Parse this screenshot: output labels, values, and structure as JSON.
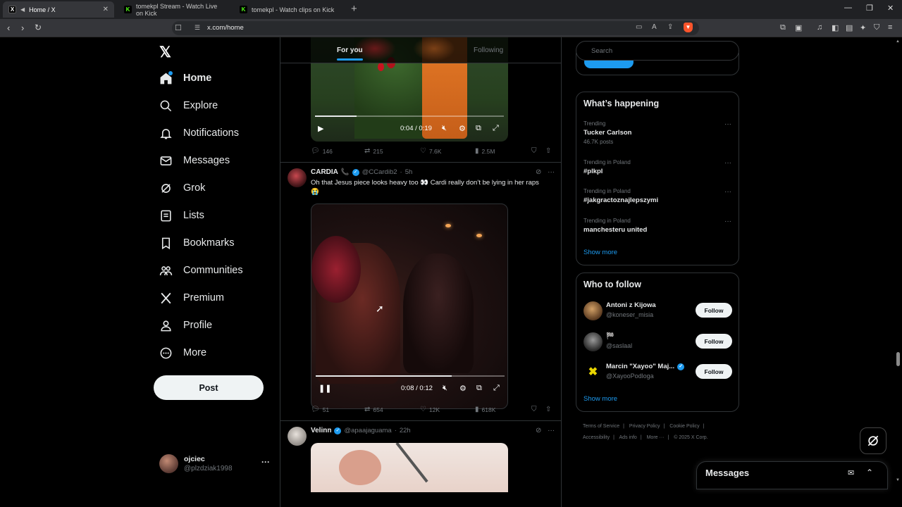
{
  "browser": {
    "tabs": [
      {
        "title": "Home / X",
        "favicon": "x-icon",
        "active": true
      },
      {
        "title": "tomekpl Stream - Watch Live on Kick",
        "favicon": "kick-icon",
        "active": false
      },
      {
        "title": "tomekpl - Watch clips on Kick",
        "favicon": "kick-icon",
        "active": false
      }
    ],
    "url": "x.com/home"
  },
  "nav": {
    "items": [
      {
        "label": "Home",
        "icon": "home-icon"
      },
      {
        "label": "Explore",
        "icon": "search-icon"
      },
      {
        "label": "Notifications",
        "icon": "bell-icon"
      },
      {
        "label": "Messages",
        "icon": "envelope-icon"
      },
      {
        "label": "Grok",
        "icon": "grok-icon"
      },
      {
        "label": "Lists",
        "icon": "list-icon"
      },
      {
        "label": "Bookmarks",
        "icon": "bookmark-icon"
      },
      {
        "label": "Communities",
        "icon": "people-icon"
      },
      {
        "label": "Premium",
        "icon": "x-icon"
      },
      {
        "label": "Profile",
        "icon": "person-icon"
      },
      {
        "label": "More",
        "icon": "more-circle-icon"
      }
    ],
    "post_label": "Post",
    "account": {
      "name": "ojciec",
      "handle": "@plzdziak1998"
    }
  },
  "timeline": {
    "tabs": [
      "For you",
      "Following"
    ],
    "posts": [
      {
        "video_time": "0:04 / 0:19",
        "video_progress": 0.22,
        "stats": {
          "replies": "146",
          "reposts": "215",
          "likes": "7.6K",
          "views": "2.5M"
        }
      },
      {
        "name": "CARDIA",
        "emoji": "📞",
        "handle": "@CCardib2",
        "time": "5h",
        "text": "Oh that Jesus piece looks heavy too 👀 Cardi really don’t be lying in her raps😭",
        "video_time": "0:08 / 0:12",
        "video_progress": 0.72,
        "stats": {
          "replies": "51",
          "reposts": "654",
          "likes": "12K",
          "views": "618K"
        }
      },
      {
        "name": "Velinn",
        "handle": "@apaajaguama",
        "time": "22h"
      }
    ]
  },
  "sidebar": {
    "search_placeholder": "Search",
    "happening": {
      "title": "What’s happening",
      "trends": [
        {
          "context": "Trending",
          "title": "Tucker Carlson",
          "count": "46.7K posts"
        },
        {
          "context": "Trending in Poland",
          "title": "#plkpl",
          "count": ""
        },
        {
          "context": "Trending in Poland",
          "title": "#jakgractoznajlepszymi",
          "count": ""
        },
        {
          "context": "Trending in Poland",
          "title": "manchesteru united",
          "count": ""
        }
      ],
      "show_more": "Show more"
    },
    "who_to_follow": {
      "title": "Who to follow",
      "accounts": [
        {
          "name": "Antoni z Kijowa",
          "handle": "@koneser_misia",
          "verified": false
        },
        {
          "name": "🏁",
          "handle": "@saslaal",
          "verified": false
        },
        {
          "name": "Marcin \"Xayoo\" Maj...",
          "handle": "@XayooPodloga",
          "verified": true
        }
      ],
      "follow_label": "Follow",
      "show_more": "Show more"
    },
    "footer": [
      "Terms of Service",
      "Privacy Policy",
      "Cookie Policy",
      "Accessibility",
      "Ads info",
      "More ···",
      "© 2025 X Corp."
    ]
  },
  "messages_drawer": {
    "title": "Messages"
  },
  "colors": {
    "accent": "#1d9bf0",
    "background": "#000000",
    "text": "#e7e9ea",
    "muted": "#71767b",
    "border": "#2f3336"
  }
}
